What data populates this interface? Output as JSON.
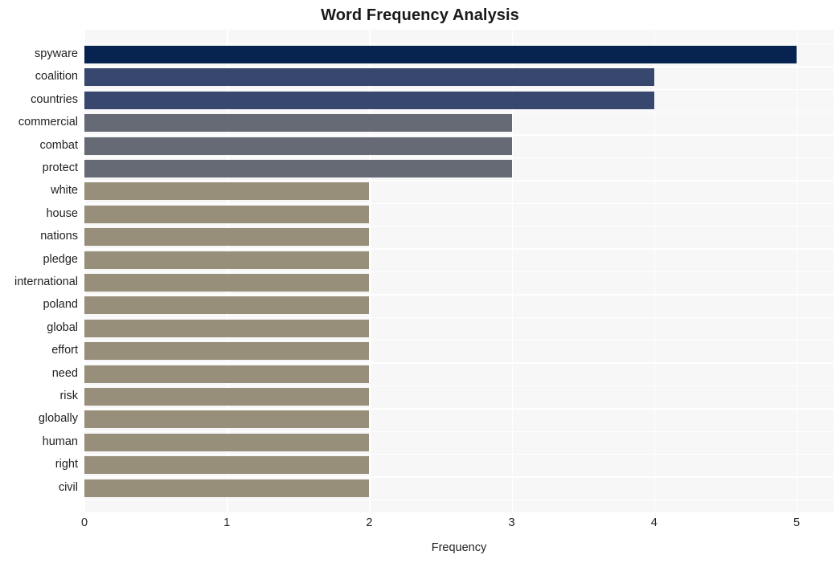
{
  "chart_data": {
    "type": "bar",
    "orientation": "horizontal",
    "title": "Word Frequency Analysis",
    "xlabel": "Frequency",
    "ylabel": "",
    "xlim": [
      0,
      5
    ],
    "xticks": [
      0,
      1,
      2,
      3,
      4,
      5
    ],
    "xtick_labels": [
      "0",
      "1",
      "2",
      "3",
      "4",
      "5"
    ],
    "grid": true,
    "legend": null,
    "categories": [
      "spyware",
      "coalition",
      "countries",
      "commercial",
      "combat",
      "protect",
      "white",
      "house",
      "nations",
      "pledge",
      "international",
      "poland",
      "global",
      "effort",
      "need",
      "risk",
      "globally",
      "human",
      "right",
      "civil"
    ],
    "values": [
      5,
      4,
      4,
      3,
      3,
      3,
      2,
      2,
      2,
      2,
      2,
      2,
      2,
      2,
      2,
      2,
      2,
      2,
      2,
      2
    ],
    "bar_colors": [
      "#072450",
      "#38476e",
      "#38476e",
      "#656a75",
      "#656a75",
      "#656a75",
      "#978f79",
      "#978f79",
      "#978f79",
      "#978f79",
      "#978f79",
      "#978f79",
      "#978f79",
      "#978f79",
      "#978f79",
      "#978f79",
      "#978f79",
      "#978f79",
      "#978f79",
      "#978f79"
    ]
  },
  "style": {
    "plot_background": "#f7f7f7",
    "figure_background": "#ffffff",
    "gridline_color": "#ffffff",
    "text_color": "#222222",
    "title_color": "#1a1a1a"
  }
}
